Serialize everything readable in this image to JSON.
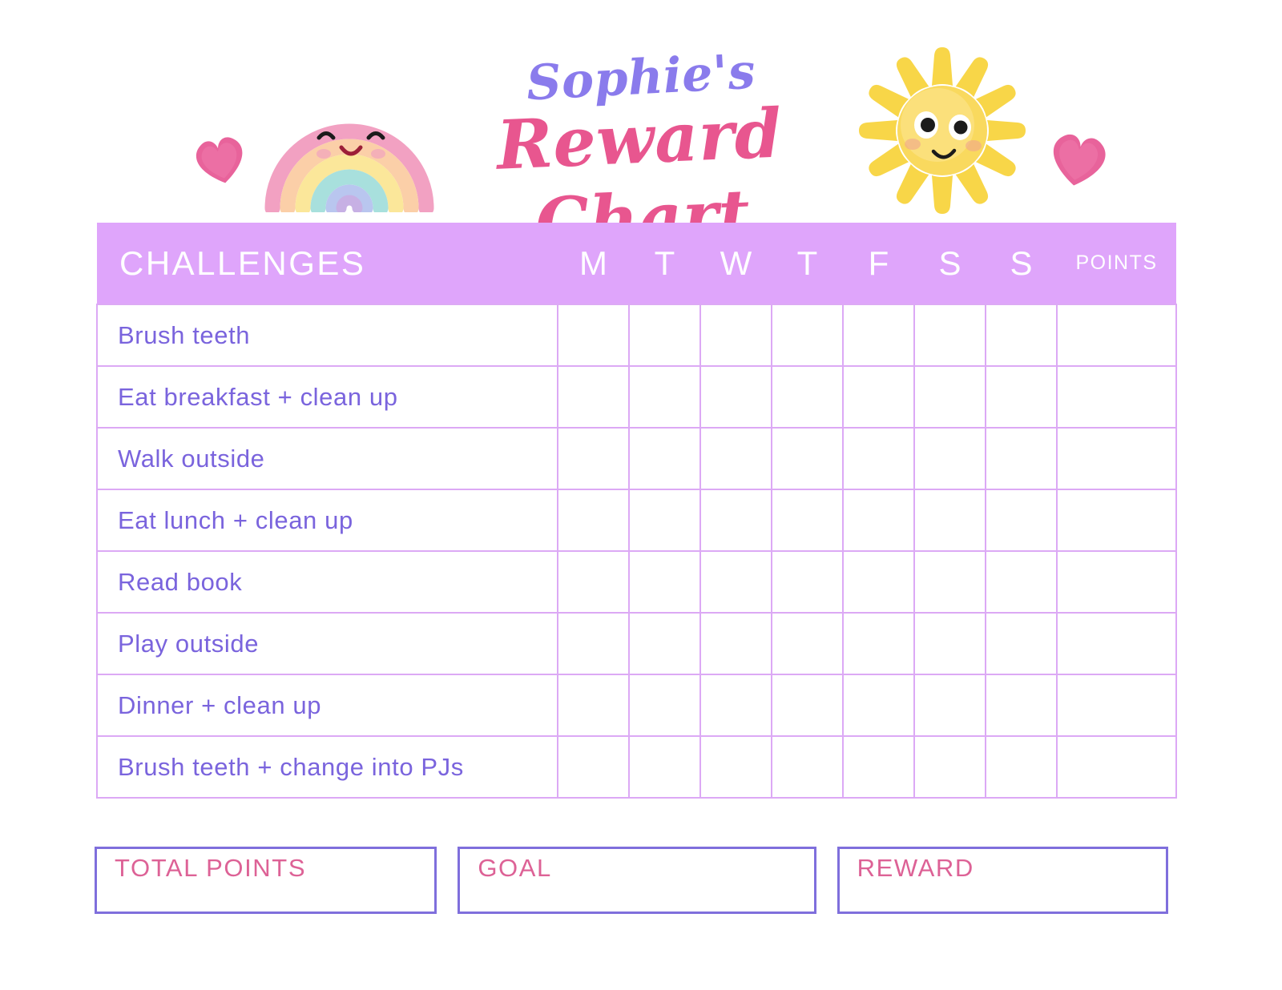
{
  "title": {
    "line1": "Sophie's",
    "line2": "Reward Chart"
  },
  "decorations": [
    {
      "name": "rainbow-icon",
      "label": "smiling watercolor rainbow"
    },
    {
      "name": "sun-icon",
      "label": "smiling watercolor sun"
    },
    {
      "name": "heart-icon-left",
      "label": "pink watercolor heart"
    },
    {
      "name": "heart-icon-right",
      "label": "pink watercolor heart"
    }
  ],
  "table": {
    "headers": {
      "challenges": "CHALLENGES",
      "days": [
        "M",
        "T",
        "W",
        "T",
        "F",
        "S",
        "S"
      ],
      "points": "POINTS"
    },
    "rows": [
      {
        "task": "Brush teeth",
        "marks": [
          "",
          "",
          "",
          "",
          "",
          "",
          ""
        ],
        "points": ""
      },
      {
        "task": "Eat breakfast + clean up",
        "marks": [
          "",
          "",
          "",
          "",
          "",
          "",
          ""
        ],
        "points": ""
      },
      {
        "task": "Walk outside",
        "marks": [
          "",
          "",
          "",
          "",
          "",
          "",
          ""
        ],
        "points": ""
      },
      {
        "task": "Eat lunch + clean up",
        "marks": [
          "",
          "",
          "",
          "",
          "",
          "",
          ""
        ],
        "points": ""
      },
      {
        "task": "Read book",
        "marks": [
          "",
          "",
          "",
          "",
          "",
          "",
          ""
        ],
        "points": ""
      },
      {
        "task": "Play outside",
        "marks": [
          "",
          "",
          "",
          "",
          "",
          "",
          ""
        ],
        "points": ""
      },
      {
        "task": "Dinner + clean up",
        "marks": [
          "",
          "",
          "",
          "",
          "",
          "",
          ""
        ],
        "points": ""
      },
      {
        "task": "Brush teeth + change into PJs",
        "marks": [
          "",
          "",
          "",
          "",
          "",
          "",
          ""
        ],
        "points": ""
      }
    ]
  },
  "footer": {
    "total_points_label": "TOTAL POINTS",
    "total_points_value": "",
    "goal_label": "GOAL",
    "goal_value": "",
    "reward_label": "REWARD",
    "reward_value": ""
  },
  "colors": {
    "title_name": "#8a7bec",
    "title_main": "#e8568f",
    "header_bg": "#dfa5fb",
    "grid_line": "#dca9f5",
    "task_text": "#7a64dd",
    "box_border": "#7f6fdc",
    "box_label": "#dd6296",
    "heart": "#e8639b",
    "sun": "#f8d648",
    "page_bg": "#ffffff"
  }
}
